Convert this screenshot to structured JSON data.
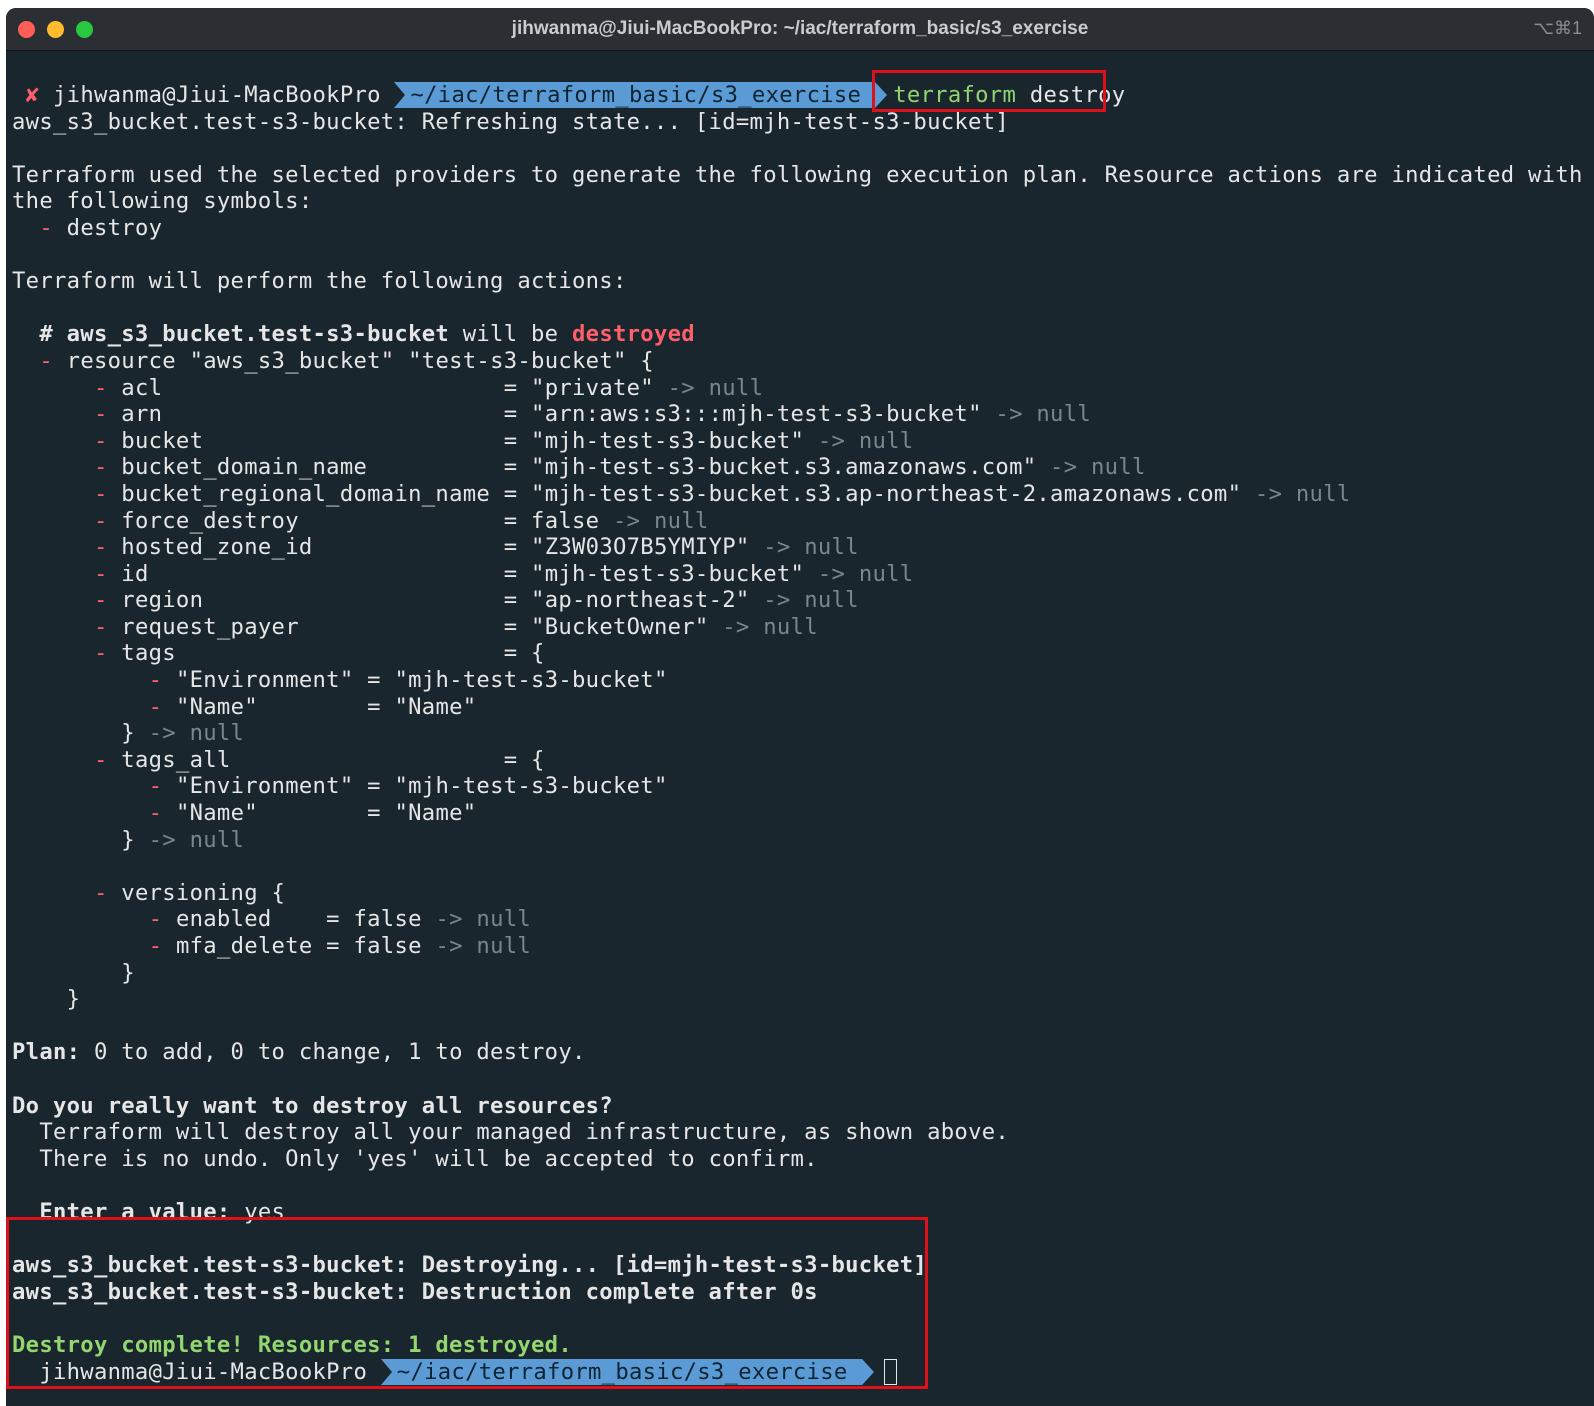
{
  "window": {
    "title": "jihwanma@Jiui-MacBookPro: ~/iac/terraform_basic/s3_exercise",
    "shortcut": "⌥⌘1"
  },
  "prompt": {
    "status_icon": "✘",
    "host": "jihwanma@Jiui-MacBookPro",
    "path": "~/iac/terraform_basic/s3_exercise",
    "cmd_name": "terraform",
    "cmd_arg": "destroy"
  },
  "out": {
    "refresh": "aws_s3_bucket.test-s3-bucket: Refreshing state... [id=mjh-test-s3-bucket]",
    "info1": "Terraform used the selected providers to generate the following execution plan. Resource actions are indicated with",
    "info2": "the following symbols:",
    "sym_label": "destroy",
    "perform": "Terraform will perform the following actions:",
    "comment_hash": "# aws_s3_bucket.test-s3-bucket",
    "comment_will": " will be ",
    "comment_destroyed": "destroyed",
    "resource": "resource \"aws_s3_bucket\" \"test-s3-bucket\" {",
    "attrs": [
      {
        "k": "acl                         = \"private\"",
        "s": " -> null"
      },
      {
        "k": "arn                         = \"arn:aws:s3:::mjh-test-s3-bucket\"",
        "s": " -> null"
      },
      {
        "k": "bucket                      = \"mjh-test-s3-bucket\"",
        "s": " -> null"
      },
      {
        "k": "bucket_domain_name          = \"mjh-test-s3-bucket.s3.amazonaws.com\"",
        "s": " -> null"
      },
      {
        "k": "bucket_regional_domain_name = \"mjh-test-s3-bucket.s3.ap-northeast-2.amazonaws.com\"",
        "s": " -> null"
      },
      {
        "k": "force_destroy               = false",
        "s": " -> null"
      },
      {
        "k": "hosted_zone_id              = \"Z3W03O7B5YMIYP\"",
        "s": " -> null"
      },
      {
        "k": "id                          = \"mjh-test-s3-bucket\"",
        "s": " -> null"
      },
      {
        "k": "region                      = \"ap-northeast-2\"",
        "s": " -> null"
      },
      {
        "k": "request_payer               = \"BucketOwner\"",
        "s": " -> null"
      }
    ],
    "tags_open": "tags                        = {",
    "tags_env": "\"Environment\" = \"mjh-test-s3-bucket\"",
    "tags_name": "\"Name\"        = \"Name\"",
    "close_brace": "}",
    "arrow_null": " -> null",
    "tags_all_open": "tags_all                    = {",
    "versioning_open": "versioning {",
    "ver_enabled": "enabled    = false",
    "ver_mfa": "mfa_delete = false",
    "plan_label": "Plan:",
    "plan_text": " 0 to add, 0 to change, 1 to destroy.",
    "confirm_q": "Do you really want to destroy all resources?",
    "confirm_1": "Terraform will destroy all your managed infrastructure, as shown above.",
    "confirm_2": "There is no undo. Only 'yes' will be accepted to confirm.",
    "enter_label": "Enter a value:",
    "enter_value": " yes",
    "destroying": "aws_s3_bucket.test-s3-bucket: Destroying... [id=mjh-test-s3-bucket]",
    "destroyed": "aws_s3_bucket.test-s3-bucket: Destruction complete after 0s",
    "complete": "Destroy complete! Resources: 1 destroyed."
  },
  "colors": {
    "background": "#19262e",
    "path_segment": "#5b9bd5",
    "destroy_marker": "#ff5f6a",
    "success": "#93d56f",
    "highlight_box": "#e0101a"
  }
}
